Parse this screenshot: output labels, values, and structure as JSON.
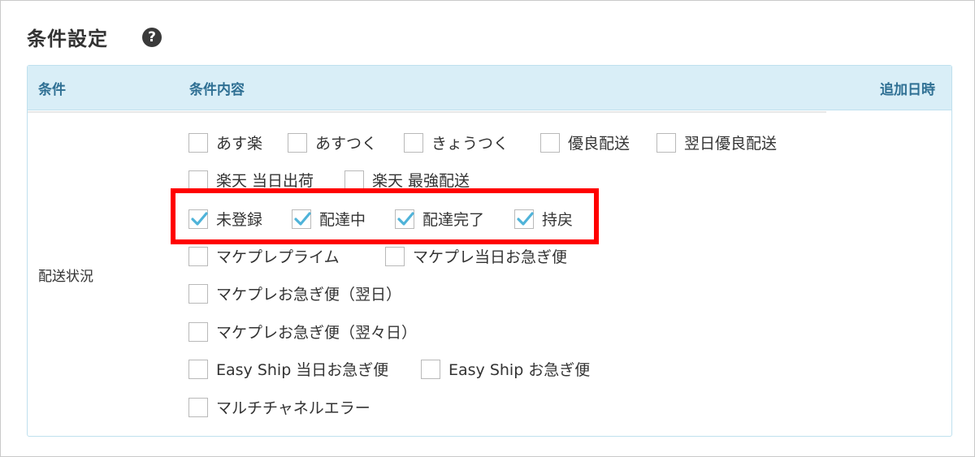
{
  "section": {
    "title": "条件設定"
  },
  "table": {
    "headers": {
      "condition": "条件",
      "content": "条件内容",
      "added": "追加日時"
    },
    "row_label": "配送状況"
  },
  "options": [
    {
      "label": "あす楽",
      "checked": false
    },
    {
      "label": "あすつく",
      "checked": false
    },
    {
      "label": "きょうつく",
      "checked": false
    },
    {
      "label": "優良配送",
      "checked": false
    },
    {
      "label": "翌日優良配送",
      "checked": false
    },
    {
      "label": "楽天 当日出荷",
      "checked": false
    },
    {
      "label": "楽天 最強配送",
      "checked": false
    },
    {
      "label": "未登録",
      "checked": true
    },
    {
      "label": "配達中",
      "checked": true
    },
    {
      "label": "配達完了",
      "checked": true
    },
    {
      "label": "持戻",
      "checked": true
    },
    {
      "label": "マケプレプライム",
      "checked": false
    },
    {
      "label": "マケプレ当日お急ぎ便",
      "checked": false
    },
    {
      "label": "マケプレお急ぎ便（翌日）",
      "checked": false
    },
    {
      "label": "マケプレお急ぎ便（翌々日）",
      "checked": false
    },
    {
      "label": "Easy Ship 当日お急ぎ便",
      "checked": false
    },
    {
      "label": "Easy Ship お急ぎ便",
      "checked": false
    },
    {
      "label": "マルチチャネルエラー",
      "checked": false
    }
  ],
  "colors": {
    "header_bg": "#d9eef7",
    "header_text": "#2e6f93",
    "check": "#4fb3d9",
    "highlight": "#ff0000"
  }
}
